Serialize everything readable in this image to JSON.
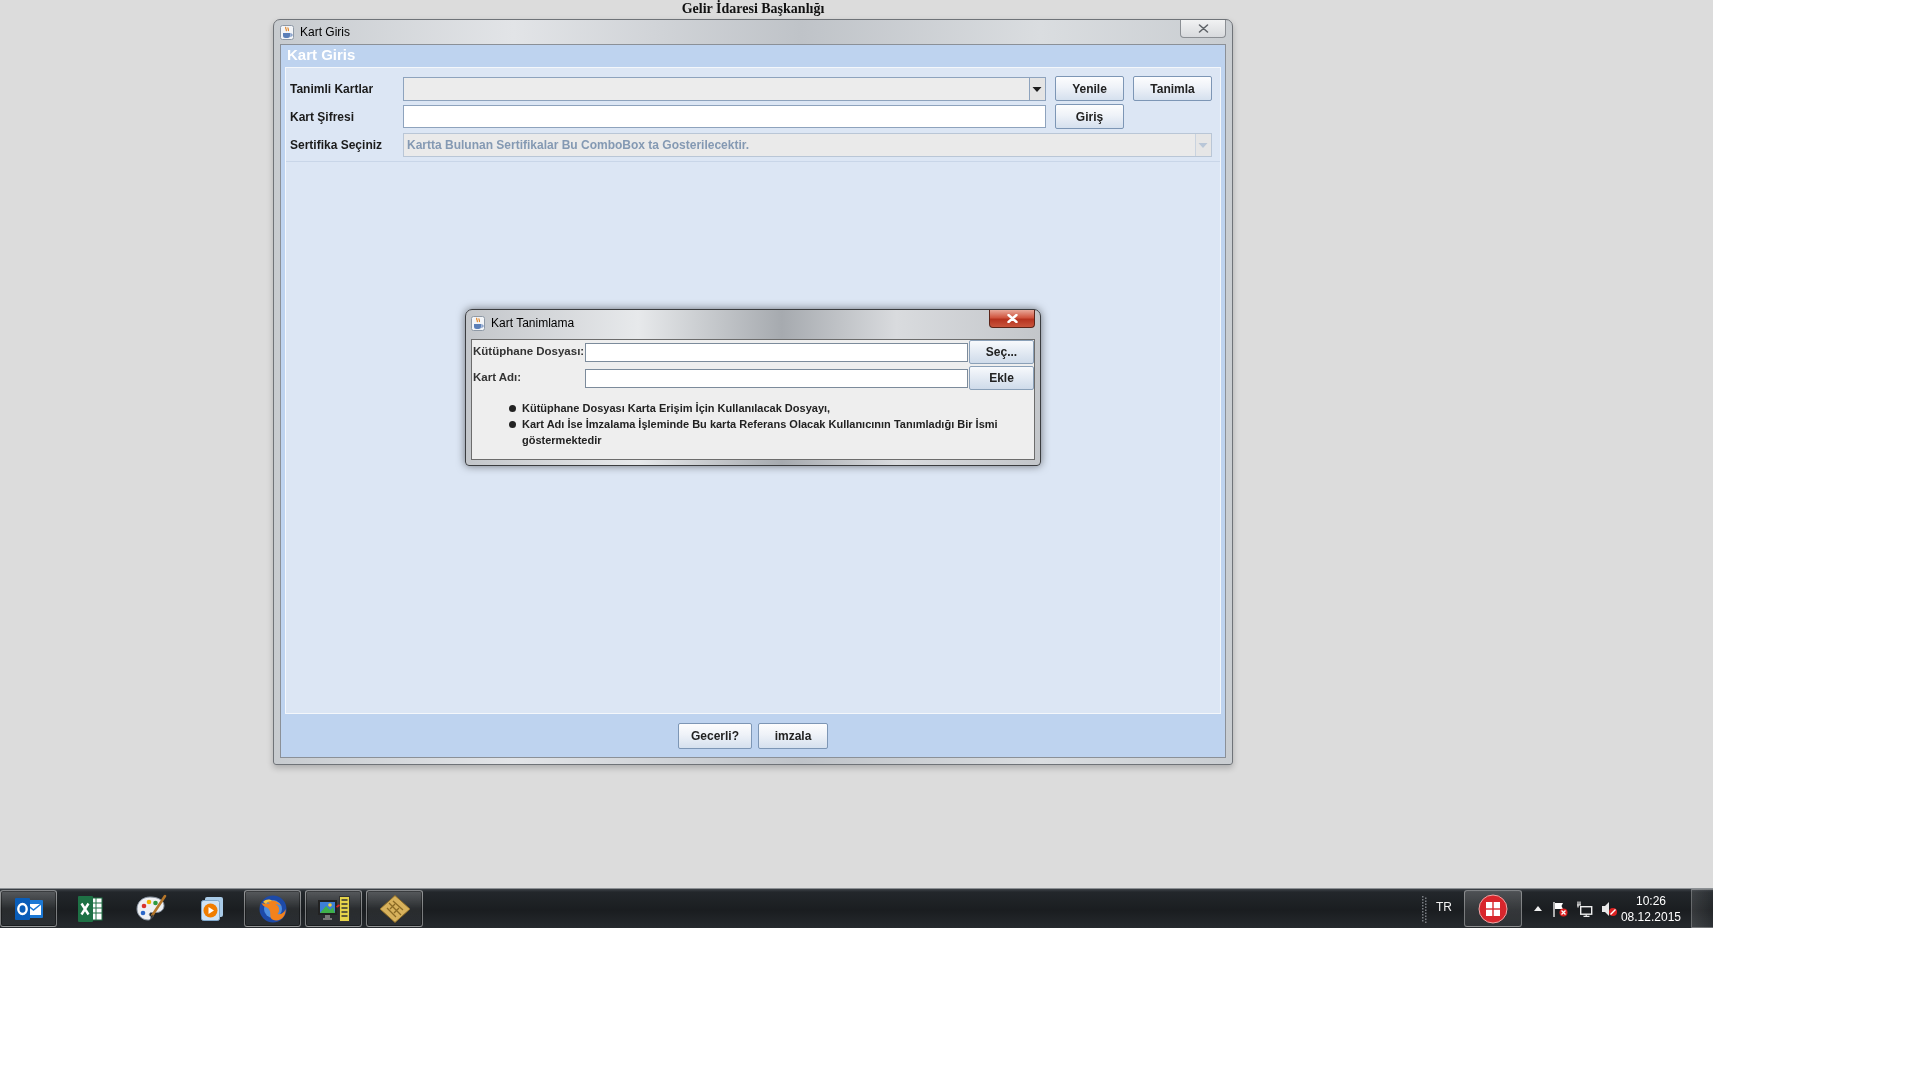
{
  "desktop": {
    "background_text": "Gelir İdaresi Başkanlığı"
  },
  "main_window": {
    "title": "Kart Giris",
    "active": false,
    "header": "Kart Giris",
    "form_rows": [
      {
        "kind": "combo",
        "label": "Tanimli Kartlar",
        "disabled": false,
        "buttons": [
          "Yenile",
          "Tanimla"
        ]
      },
      {
        "kind": "password",
        "label": "Kart Şifresi",
        "disabled": false,
        "buttons": [
          "Giriş"
        ]
      },
      {
        "kind": "combo",
        "label": "Sertifika Seçiniz",
        "disabled": true,
        "placeholder": "Kartta Bulunan Sertifikalar Bu ComboBox ta Gosterilecektir."
      }
    ],
    "footer_buttons": [
      "Gecerli?",
      "imzala"
    ]
  },
  "dialog": {
    "title": "Kart Tanimlama",
    "active": true,
    "fields": [
      {
        "label": "Kütüphane Dosyası:",
        "button": "Seç..."
      },
      {
        "label": "Kart Adı:",
        "button": "Ekle"
      }
    ],
    "notes": [
      "Kütüphane Dosyası Karta Erişim İçin Kullanılacak Dosyayı,",
      "Kart Adı İse İmzalama İşleminde Bu karta Referans Olacak Kullanıcının Tanımladığı Bir İsmi göstermektedir"
    ]
  },
  "taskbar": {
    "apps": [
      {
        "kind": "mail",
        "running": true
      },
      {
        "kind": "spreadsheet",
        "running": false
      },
      {
        "kind": "paint",
        "running": false
      },
      {
        "kind": "media",
        "running": false
      },
      {
        "kind": "browser",
        "running": true
      },
      {
        "kind": "remote",
        "running": true
      },
      {
        "kind": "card",
        "running": true
      }
    ],
    "language": "TR",
    "clock": {
      "time": "10:26",
      "date": "08.12.2015"
    }
  }
}
